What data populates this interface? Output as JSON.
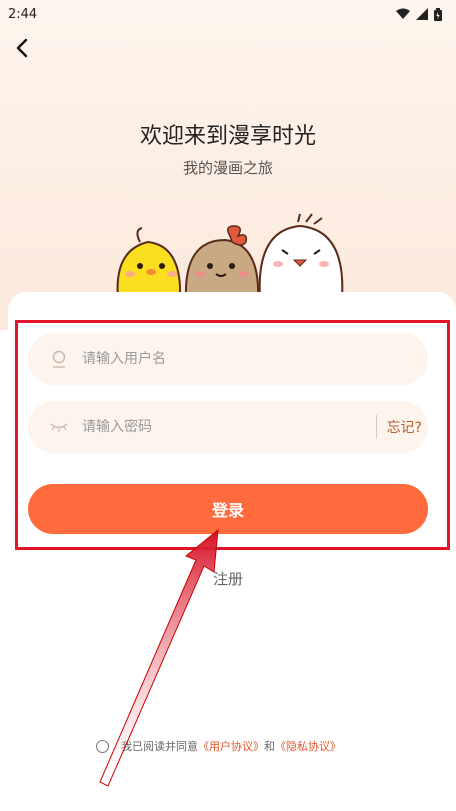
{
  "status_bar": {
    "time": "2:44"
  },
  "header": {
    "title": "欢迎来到漫享时光",
    "subtitle": "我的漫画之旅"
  },
  "login_form": {
    "username_placeholder": "请输入用户名",
    "password_placeholder": "请输入密码",
    "forgot_label": "忘记?",
    "login_label": "登录"
  },
  "register_label": "注册",
  "agreement": {
    "prefix": "我已阅读并同意",
    "user_agreement": "《用户协议》",
    "and": "和",
    "privacy_agreement": "《隐私协议》"
  },
  "colors": {
    "accent": "#ff6b3c",
    "annotation": "#e0142a",
    "link": "#e4572e"
  }
}
